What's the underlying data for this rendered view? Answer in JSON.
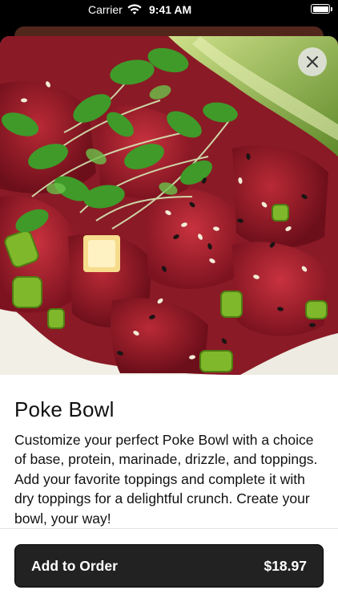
{
  "status_bar": {
    "carrier": "Carrier",
    "time": "9:41 AM",
    "wifi_icon": "wifi-icon",
    "battery_icon": "battery-icon"
  },
  "item": {
    "image_icon": "poke-bowl-photo",
    "title": "Poke Bowl",
    "description": "Customize your perfect Poke Bowl with a choice of base, protein, marinade, drizzle, and toppings. Add your favorite toppings and complete it with dry toppings for a delightful crunch. Create your bowl, your way!"
  },
  "close_icon": "close-icon",
  "order_button": {
    "label": "Add to Order",
    "price": "$18.97"
  },
  "colors": {
    "button_bg": "#222222",
    "text": "#111111",
    "background": "#ffffff"
  }
}
